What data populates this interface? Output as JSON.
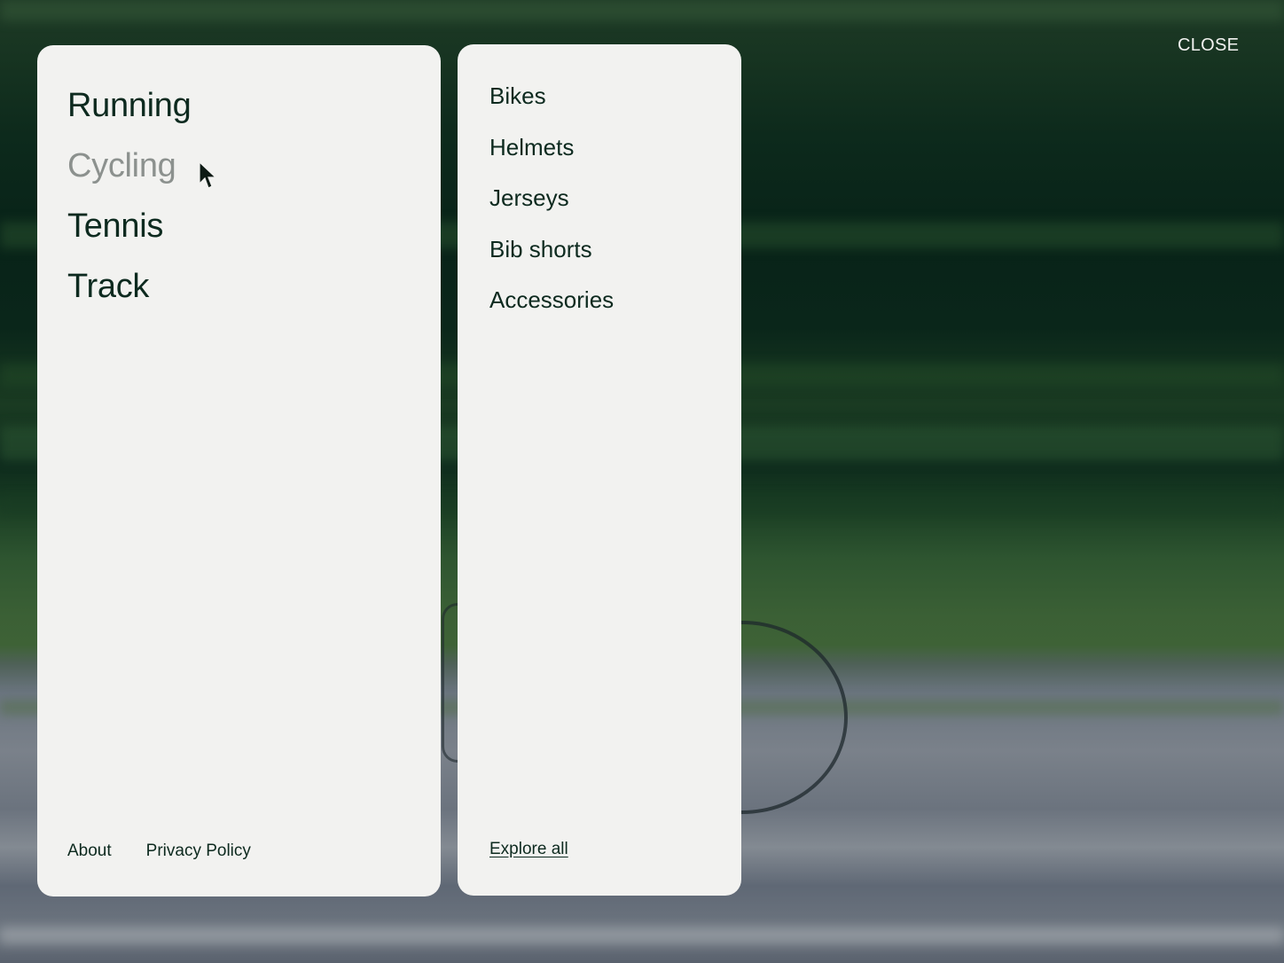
{
  "close_label": "CLOSE",
  "categories": [
    {
      "label": "Running",
      "active": false
    },
    {
      "label": "Cycling",
      "active": true
    },
    {
      "label": "Tennis",
      "active": false
    },
    {
      "label": "Track",
      "active": false
    }
  ],
  "footer": {
    "about": "About",
    "privacy": "Privacy Policy"
  },
  "subcategories": [
    "Bikes",
    "Helmets",
    "Jerseys",
    "Bib shorts",
    "Accessories"
  ],
  "explore_all": "Explore all",
  "colors": {
    "panel": "#f2f2f0",
    "text": "#0d2a1f",
    "active_text": "#8c918e"
  },
  "cursor_icon": "mouse-pointer-icon"
}
